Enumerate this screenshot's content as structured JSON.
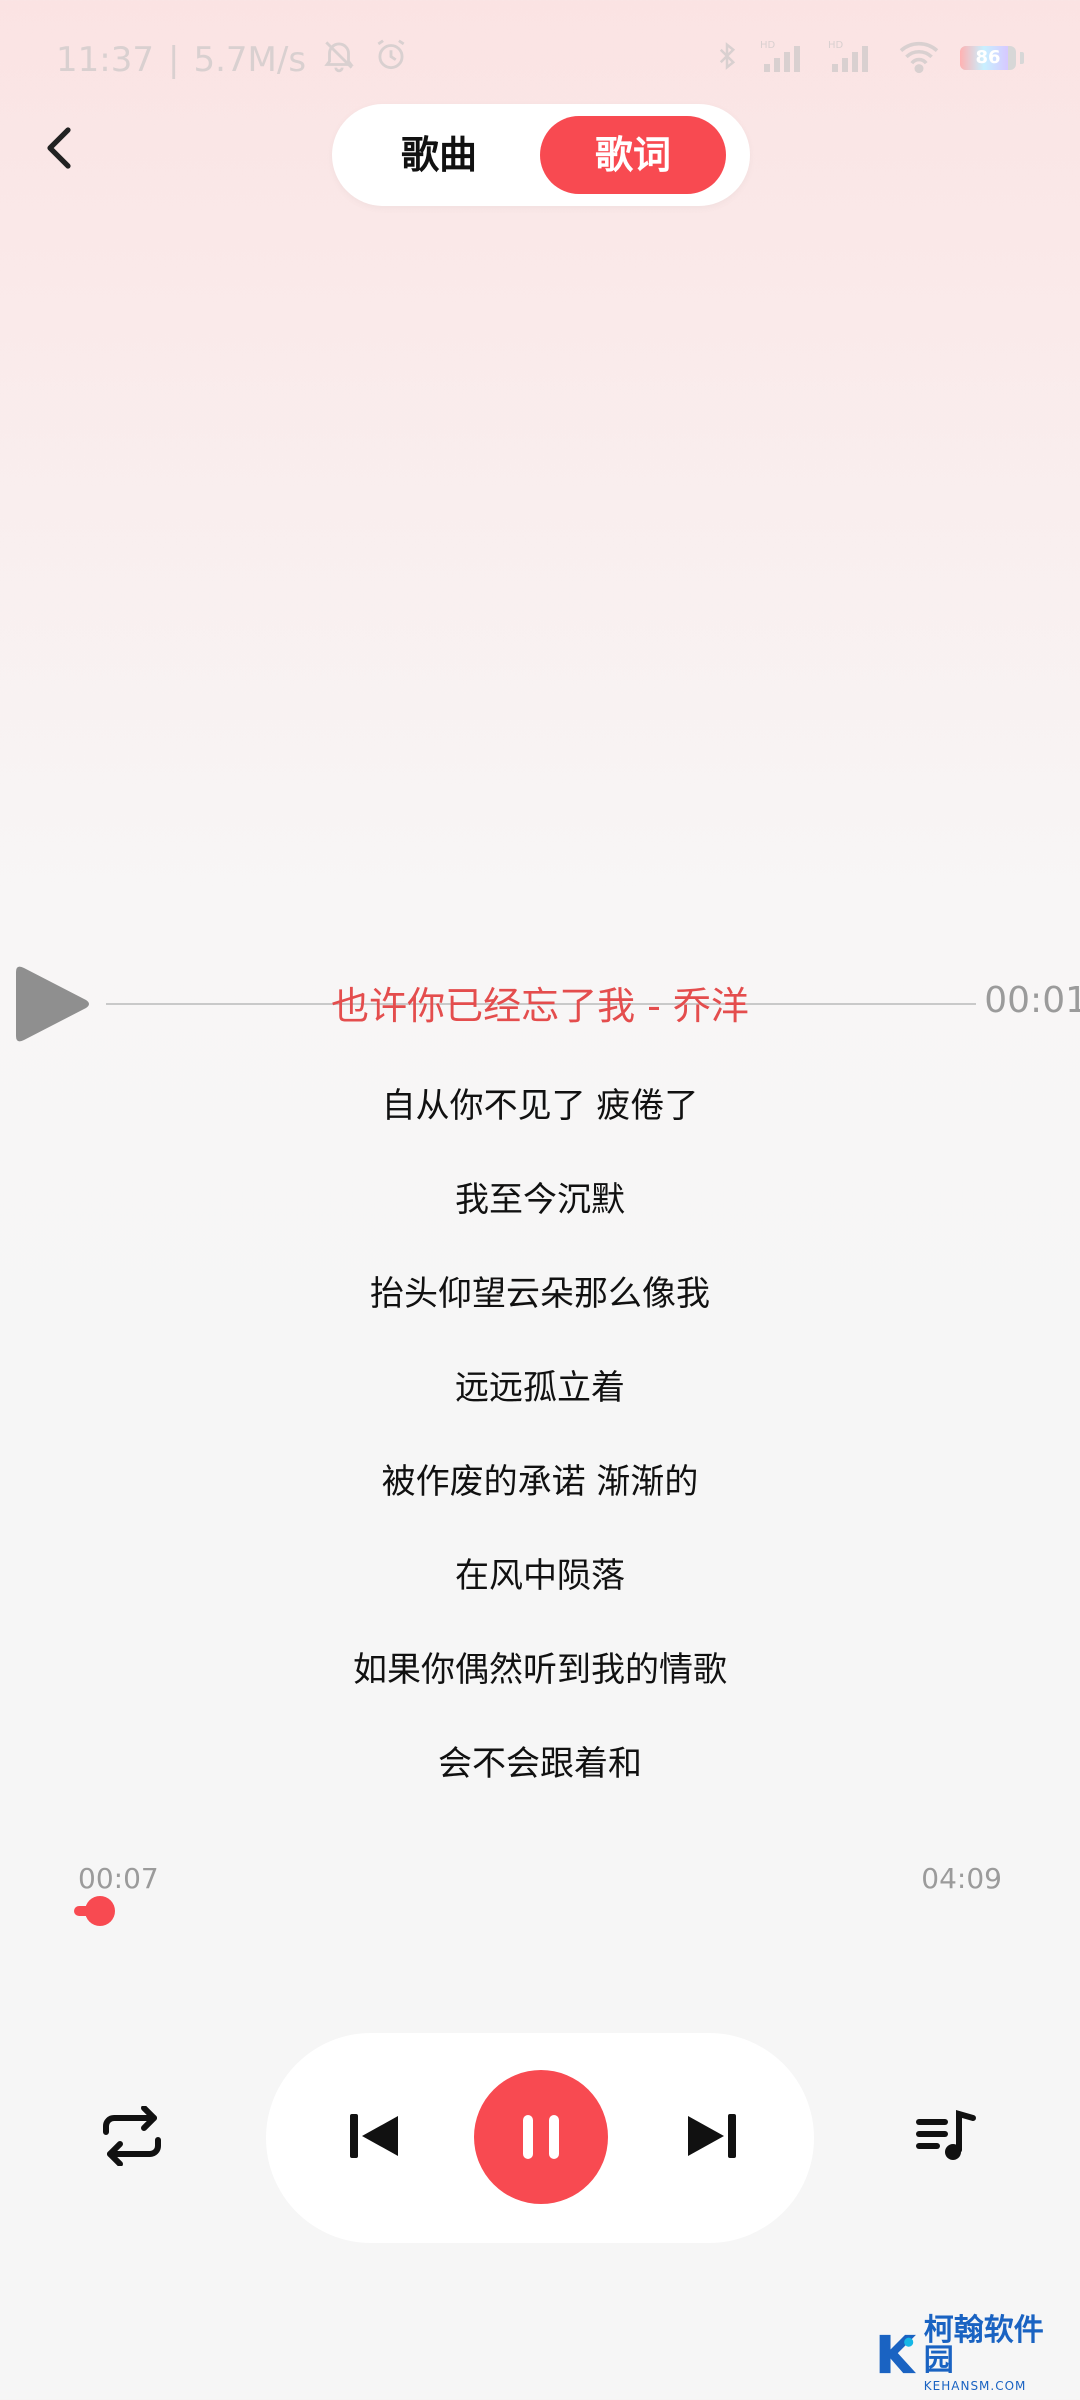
{
  "status_bar": {
    "time": "11:37",
    "separator": "|",
    "network_speed": "5.7M/s",
    "battery_percent": "86",
    "battery_level": 0.86
  },
  "header": {
    "tabs": [
      {
        "label": "歌曲",
        "active": false
      },
      {
        "label": "歌词",
        "active": true
      }
    ]
  },
  "lyrics": {
    "current_title": "也许你已经忘了我 - 乔洋",
    "seek_time": "00:01",
    "lines": [
      "自从你不见了 疲倦了",
      "我至今沉默",
      "抬头仰望云朵那么像我",
      "远远孤立着",
      "被作废的承诺 渐渐的",
      "在风中陨落",
      "如果你偶然听到我的情歌",
      "会不会跟着和"
    ]
  },
  "playback": {
    "current_time": "00:07",
    "total_time": "04:09",
    "progress_fraction": 0.028
  },
  "watermark": {
    "main": "柯翰软件园",
    "sub": "KEHANSM.COM"
  },
  "colors": {
    "accent": "#f84a51",
    "current_lyric": "#e44d4d"
  }
}
